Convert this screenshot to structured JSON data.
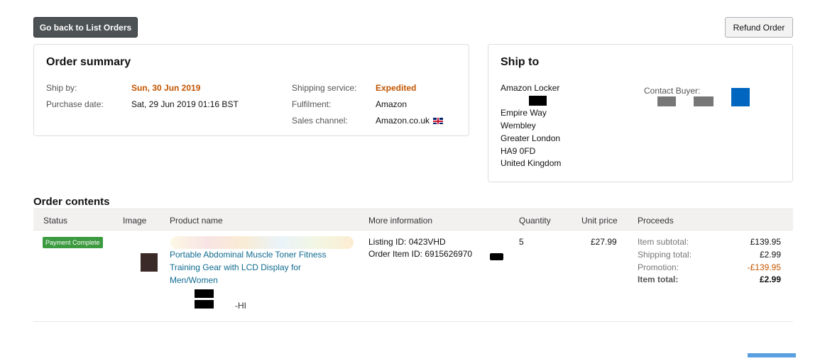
{
  "toolbar": {
    "back_label": "Go back to List Orders",
    "refund_label": "Refund Order"
  },
  "summary": {
    "title": "Order summary",
    "ship_by_label": "Ship by:",
    "ship_by_value": "Sun, 30 Jun 2019",
    "purchase_date_label": "Purchase date:",
    "purchase_date_value": "Sat, 29 Jun 2019 01:16 BST",
    "shipping_service_label": "Shipping service:",
    "shipping_service_value": "Expedited",
    "fulfilment_label": "Fulfilment:",
    "fulfilment_value": "Amazon",
    "sales_channel_label": "Sales channel:",
    "sales_channel_value": "Amazon.co.uk",
    "sales_channel_icon": "uk-flag-icon"
  },
  "ship_to": {
    "title": "Ship to",
    "lines": [
      "Amazon Locker",
      "Empire Way",
      "Wembley",
      "Greater London",
      "HA9 0FD",
      "United Kingdom"
    ],
    "contact_label": "Contact Buyer:"
  },
  "order_contents": {
    "title": "Order contents",
    "columns": [
      "Status",
      "Image",
      "Product name",
      "More information",
      "Quantity",
      "Unit price",
      "Proceeds"
    ],
    "row": {
      "status": "Payment Complete",
      "product_name": "Portable Abdominal Muscle Toner Fitness Training Gear with LCD Display for Men/Women",
      "sku_suffix": "-HI",
      "listing_id": "Listing ID: 0423VHD",
      "order_item_id": "Order Item ID: 6915626970",
      "quantity": "5",
      "unit_price": "£27.99",
      "proceeds": [
        {
          "label": "Item subtotal:",
          "value": "£139.95"
        },
        {
          "label": "Shipping total:",
          "value": "£2.99"
        },
        {
          "label": "Promotion:",
          "value": "-£139.95"
        },
        {
          "label": "Item total:",
          "value": "£2.99"
        }
      ]
    }
  },
  "colors": {
    "accent_orange": "#c45500",
    "link": "#0f6b8f",
    "status_green": "#3c9a3f"
  }
}
